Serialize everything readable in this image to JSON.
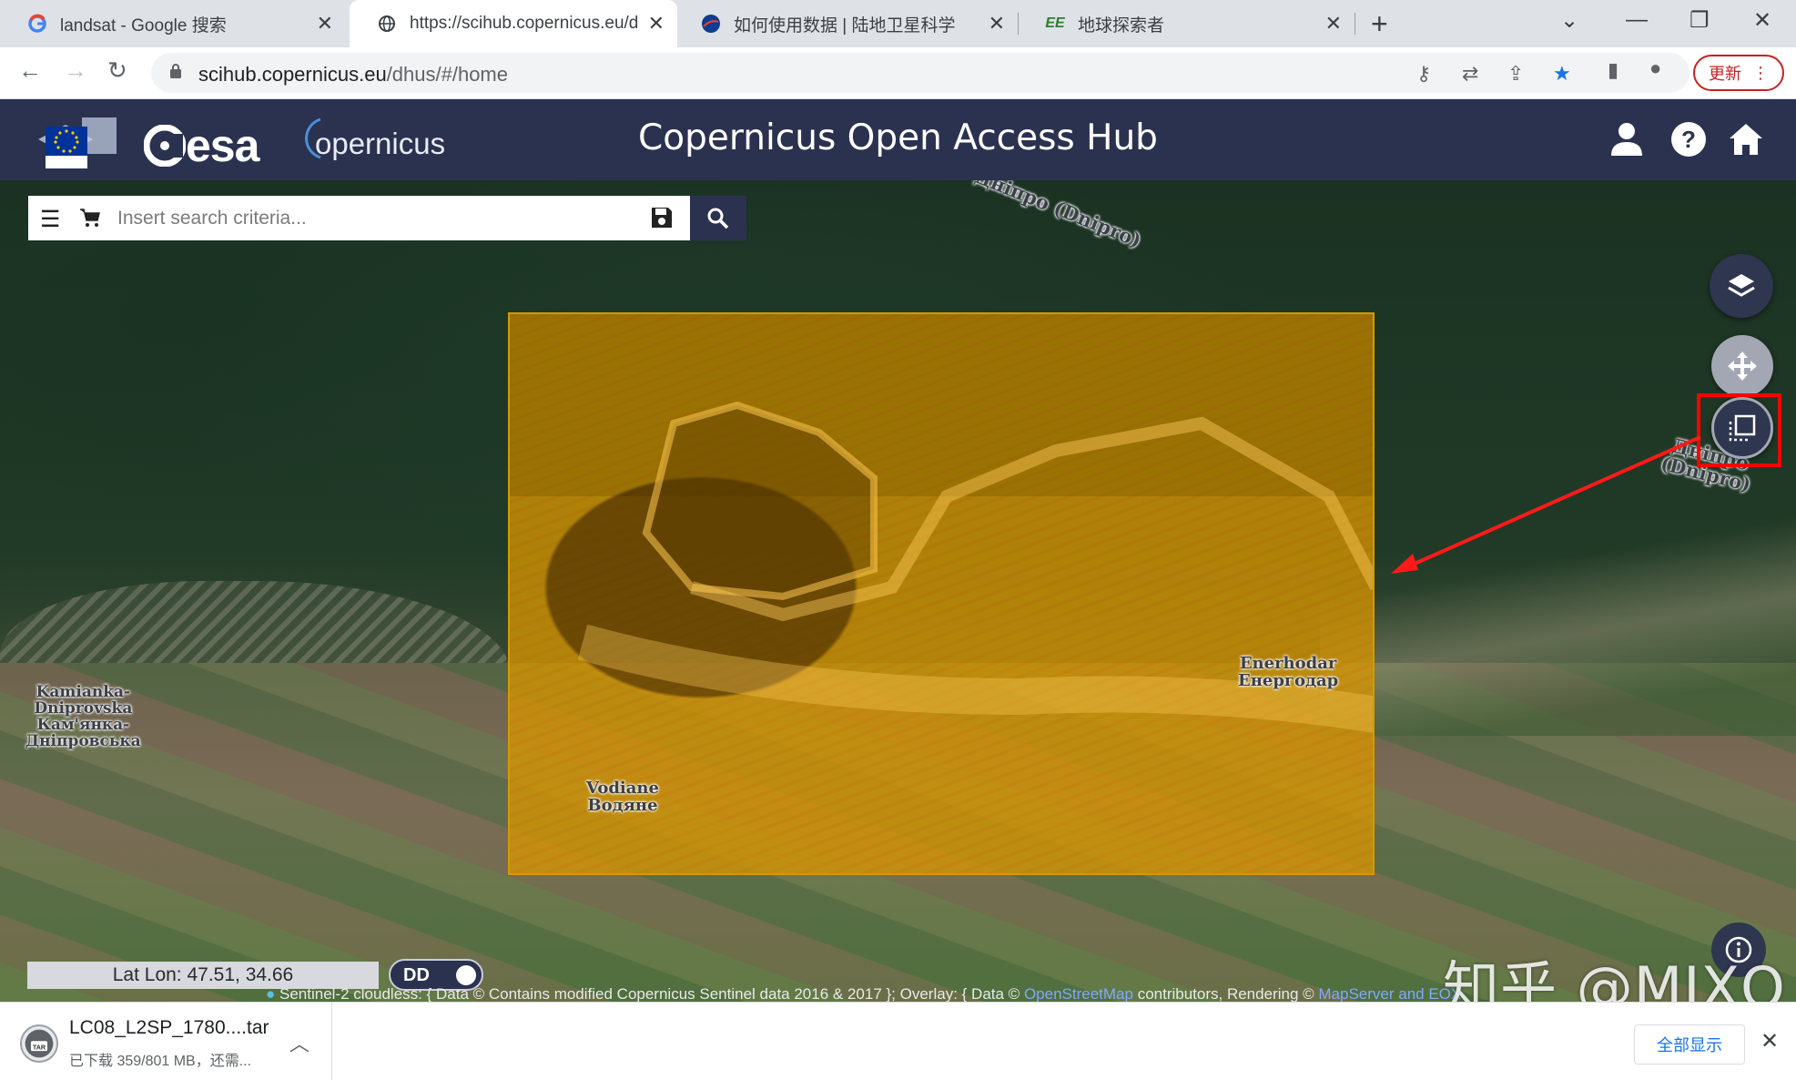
{
  "browser": {
    "tabs": [
      {
        "title": "landsat - Google 搜索",
        "favicon": "google-g-icon"
      },
      {
        "title": "https://scihub.copernicus.eu/d",
        "favicon": "globe-icon"
      },
      {
        "title": "如何使用数据 | 陆地卫星科学",
        "favicon": "nasa-icon"
      },
      {
        "title": "地球探索者",
        "favicon": "ee-icon",
        "favicon_text": "EE"
      }
    ],
    "active_tab": 1,
    "url_host": "scihub.copernicus.eu",
    "url_path": "/dhus/#/home",
    "update_label": "更新"
  },
  "app": {
    "title": "Copernicus Open Access Hub",
    "esa_logo": "esa",
    "copernicus_logo": "opernicus",
    "eu_logo_caption": "European Commission",
    "colors": {
      "header": "#2b3250",
      "selection": "#d49a00",
      "highlight": "#ff0000"
    }
  },
  "search": {
    "placeholder": "Insert search criteria..."
  },
  "map": {
    "labels": [
      {
        "text": "Дніпро (Dnipro)"
      },
      {
        "text": "Дніпро (Dnipro)"
      },
      {
        "text": "Kamianka-\nDniprovska\nКам'янка-\nДніпровська"
      },
      {
        "text": "Enerhodar\nЕнергодар"
      },
      {
        "text": "Vodiane\nВодяне"
      }
    ],
    "latlon": "Lat Lon: 47.51, 34.66",
    "coord_mode": "DD",
    "attribution_prefix": "Sentinel-2 cloudless: { Data © Contains modified Copernicus Sentinel data 2016 & 2017 }; Overlay: { Data ©",
    "attribution_osm": "OpenStreetMap",
    "attribution_suffix": "contributors, Rendering ©",
    "attribution_link": "MapServer and EOX"
  },
  "watermark": "知乎 @MIXQ",
  "download": {
    "filename": "LC08_L2SP_1780....tar",
    "status": "已下载 359/801 MB，还需...",
    "show_all": "全部显示"
  }
}
